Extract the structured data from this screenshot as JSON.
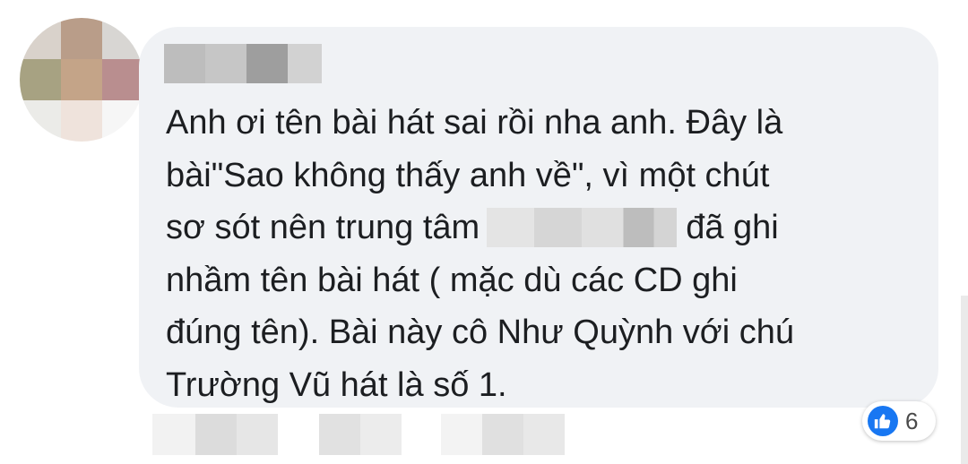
{
  "comment": {
    "text_line_1": "Anh ơi tên bài hát sai rồi nha anh. Đây là",
    "text_line_2": "bài\"Sao không thấy anh về\", vì một chút",
    "text_line_3_before": "sơ sót nên trung tâm",
    "text_line_3_after": "đã ghi",
    "text_line_4": "nhầm tên bài hát ( mặc dù các CD ghi",
    "text_line_5": "đúng tên). Bài này cô Như Quỳnh với chú",
    "text_line_6": "Trường Vũ hát là số 1."
  },
  "reactions": {
    "icon": "like-icon",
    "count": "6",
    "color": "#1877f2"
  },
  "colors": {
    "bubble": "#f0f2f5",
    "text": "#1c1e21"
  }
}
